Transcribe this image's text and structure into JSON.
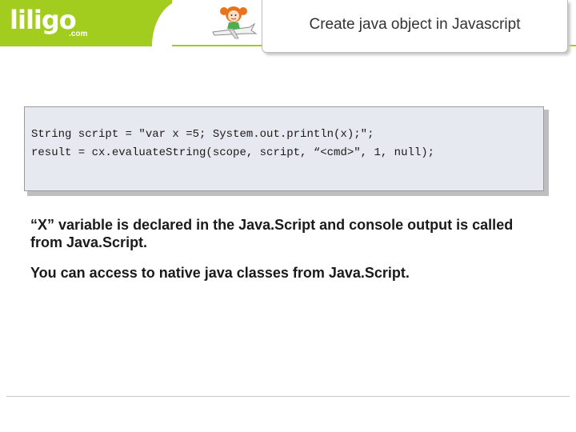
{
  "header": {
    "logo_text": "liligo",
    "logo_suffix": ".com",
    "brand_color": "#a2cc1e",
    "mascot_icon": "girl-on-plane-icon"
  },
  "slide": {
    "title": "Create java object in Javascript",
    "code": {
      "line1": "String script = \"var x =5; System.out.println(x);\";",
      "line2": "result = cx.evaluateString(scope, script, “<cmd>\", 1, null);"
    },
    "paragraphs": {
      "p1": "“X” variable is declared in the Java.Script and console output is called from Java.Script.",
      "p2": "You can access to native java classes from Java.Script."
    }
  }
}
